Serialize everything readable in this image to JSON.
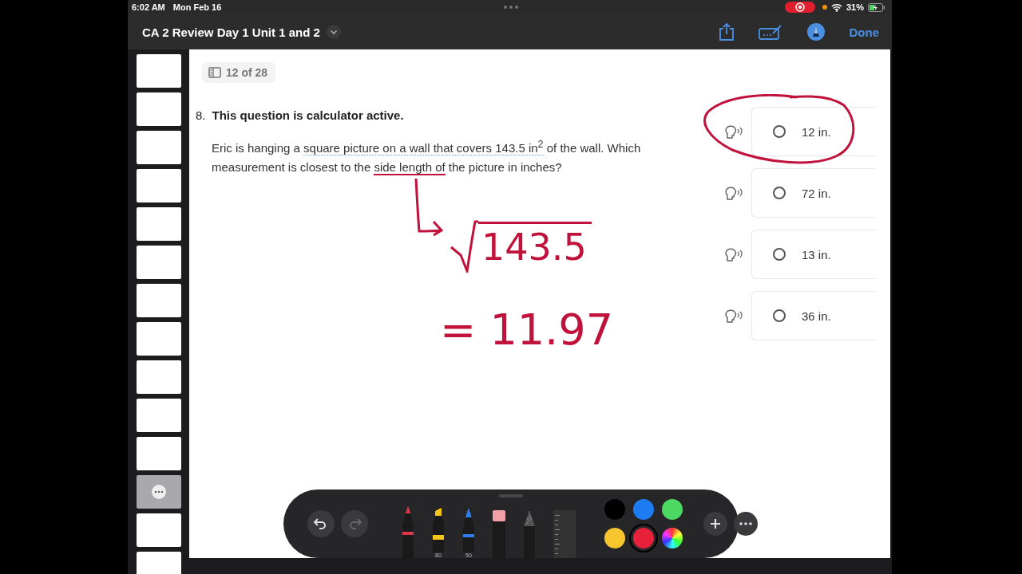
{
  "status_bar": {
    "time": "6:02 AM",
    "date": "Mon Feb 16",
    "battery": "31%",
    "recording": true
  },
  "title_bar": {
    "title": "CA 2 Review Day 1 Unit 1 and 2",
    "done": "Done"
  },
  "thumbnails": [
    {
      "selected": false
    },
    {
      "selected": false
    },
    {
      "selected": false
    },
    {
      "selected": false
    },
    {
      "selected": false
    },
    {
      "selected": false
    },
    {
      "selected": false
    },
    {
      "selected": false
    },
    {
      "selected": false
    },
    {
      "selected": false
    },
    {
      "selected": false
    },
    {
      "selected": true
    },
    {
      "selected": false
    },
    {
      "selected": false
    }
  ],
  "page": {
    "counter": "12 of 28",
    "question_number": "8.",
    "question_heading": "This question is calculator active.",
    "body": [
      {
        "kind": "plain",
        "text": "Eric is hanging a "
      },
      {
        "kind": "dotted",
        "text": "square picture on a wall that covers 143.5 in$^{2}$"
      },
      {
        "kind": "plain",
        "text": " of the wall. Which measurement is closest to the "
      },
      {
        "kind": "inked",
        "text": "side length of"
      },
      {
        "kind": "plain",
        "text": " the picture in inches?"
      }
    ],
    "answers": [
      {
        "label": "12 in.",
        "selected": false,
        "circled": true
      },
      {
        "label": "72 in.",
        "selected": false,
        "circled": false
      },
      {
        "label": "13 in.",
        "selected": false,
        "circled": false
      },
      {
        "label": "36 in.",
        "selected": false,
        "circled": false
      }
    ]
  },
  "ink": {
    "sqrt_value": "143.5",
    "result": "= 11.97"
  },
  "toolbar": {
    "tools": [
      {
        "kind": "pen",
        "color": "#e0344a"
      },
      {
        "kind": "highlighter",
        "color": "#f5c518",
        "label": "80"
      },
      {
        "kind": "pencil",
        "color": "#2f7ee8",
        "label": "50"
      },
      {
        "kind": "eraser",
        "color": "#f2a0a8"
      },
      {
        "kind": "lasso",
        "color": "#555555"
      },
      {
        "kind": "ruler",
        "color": "#333333"
      }
    ],
    "colors": [
      {
        "color": "#000000",
        "selected": false
      },
      {
        "color": "#1e7cf2",
        "selected": false
      },
      {
        "color": "#4cd964",
        "selected": false
      },
      {
        "color": "#f7c62f",
        "selected": false
      },
      {
        "color": "#e8213a",
        "selected": true
      },
      {
        "kind": "picker",
        "selected": false
      }
    ]
  }
}
